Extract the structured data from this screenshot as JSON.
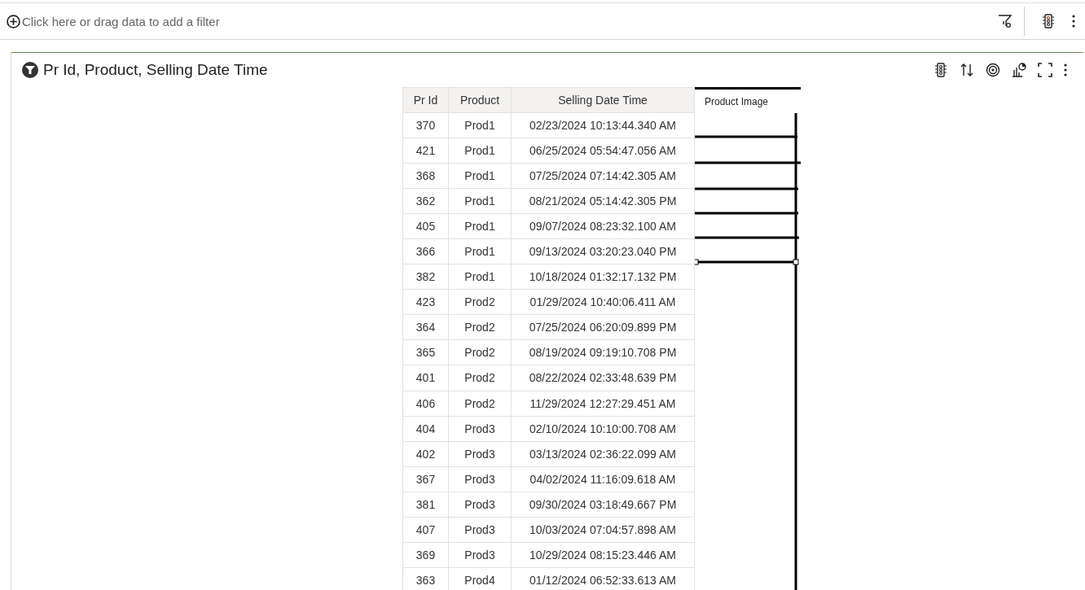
{
  "filter_bar": {
    "placeholder": "Click here or drag data to add a filter"
  },
  "panel": {
    "title": "Pr Id, Product, Selling Date Time"
  },
  "table": {
    "columns": [
      "Pr Id",
      "Product",
      "Selling Date Time"
    ],
    "drawn_column": {
      "header": "Product Image"
    },
    "rows": [
      {
        "pr_id": "370",
        "product": "Prod1",
        "selling_date_time": "02/23/2024 10:13:44.340 AM"
      },
      {
        "pr_id": "421",
        "product": "Prod1",
        "selling_date_time": "06/25/2024 05:54:47.056 AM"
      },
      {
        "pr_id": "368",
        "product": "Prod1",
        "selling_date_time": "07/25/2024 07:14:42.305 AM"
      },
      {
        "pr_id": "362",
        "product": "Prod1",
        "selling_date_time": "08/21/2024 05:14:42.305 PM"
      },
      {
        "pr_id": "405",
        "product": "Prod1",
        "selling_date_time": "09/07/2024 08:23:32.100 AM"
      },
      {
        "pr_id": "366",
        "product": "Prod1",
        "selling_date_time": "09/13/2024 03:20:23.040 PM"
      },
      {
        "pr_id": "382",
        "product": "Prod1",
        "selling_date_time": "10/18/2024 01:32:17.132 PM"
      },
      {
        "pr_id": "423",
        "product": "Prod2",
        "selling_date_time": "01/29/2024 10:40:06.411 AM"
      },
      {
        "pr_id": "364",
        "product": "Prod2",
        "selling_date_time": "07/25/2024 06:20:09.899 PM"
      },
      {
        "pr_id": "365",
        "product": "Prod2",
        "selling_date_time": "08/19/2024 09:19:10.708 PM"
      },
      {
        "pr_id": "401",
        "product": "Prod2",
        "selling_date_time": "08/22/2024 02:33:48.639 PM"
      },
      {
        "pr_id": "406",
        "product": "Prod2",
        "selling_date_time": "11/29/2024 12:27:29.451 AM"
      },
      {
        "pr_id": "404",
        "product": "Prod3",
        "selling_date_time": "02/10/2024 10:10:00.708 AM"
      },
      {
        "pr_id": "402",
        "product": "Prod3",
        "selling_date_time": "03/13/2024 02:36:22.099 AM"
      },
      {
        "pr_id": "367",
        "product": "Prod3",
        "selling_date_time": "04/02/2024 11:16:09.618 AM"
      },
      {
        "pr_id": "381",
        "product": "Prod3",
        "selling_date_time": "09/30/2024 03:18:49.667 PM"
      },
      {
        "pr_id": "407",
        "product": "Prod3",
        "selling_date_time": "10/03/2024 07:04:57.898 AM"
      },
      {
        "pr_id": "369",
        "product": "Prod3",
        "selling_date_time": "10/29/2024 08:15:23.446 AM"
      },
      {
        "pr_id": "363",
        "product": "Prod4",
        "selling_date_time": "01/12/2024 06:52:33.613 AM"
      }
    ]
  }
}
